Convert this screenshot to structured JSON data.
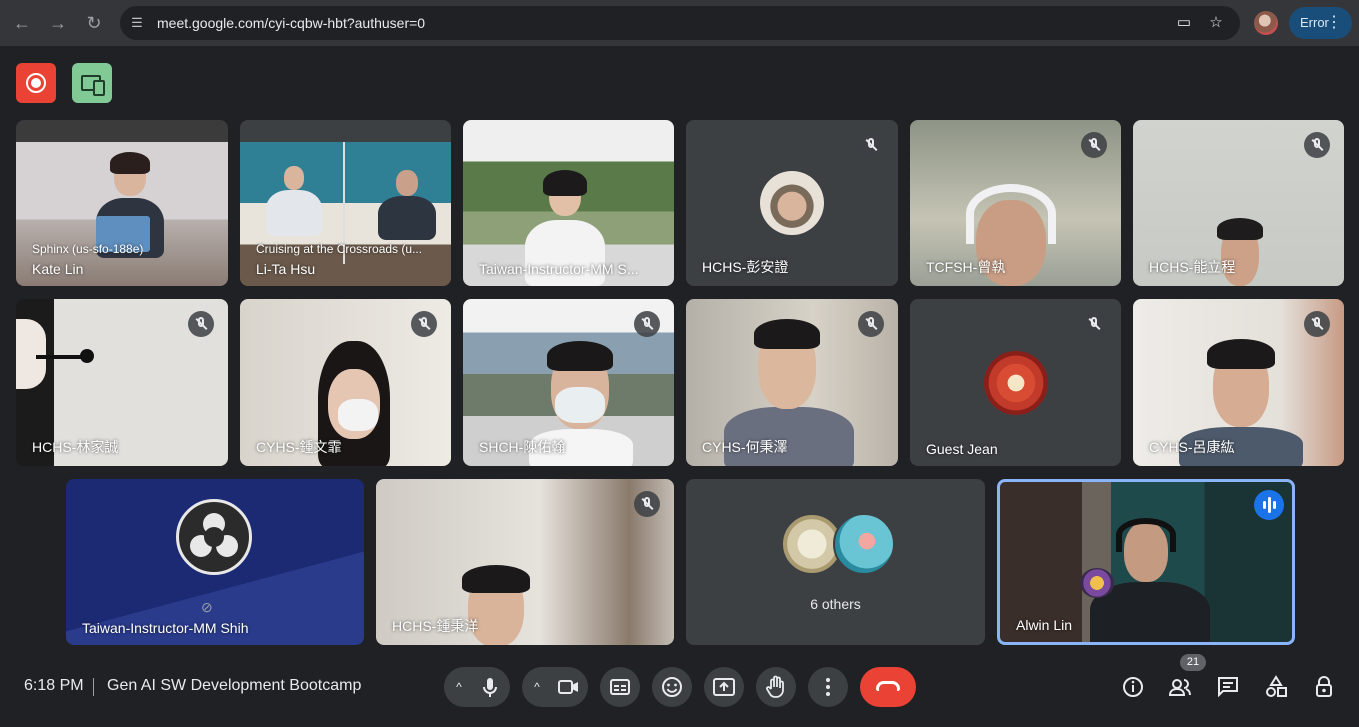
{
  "browser": {
    "url": "meet.google.com/cyi-cqbw-hbt?authuser=0",
    "error_label": "Error"
  },
  "tiles": [
    {
      "name": "Kate Lin",
      "subtitle": "Sphinx (us-sfo-188e)"
    },
    {
      "name": "Li-Ta Hsu",
      "subtitle": "Cruising at the Crossroads (u..."
    },
    {
      "name": "Taiwan-Instructor-MM S..."
    },
    {
      "name": "HCHS-彭安證"
    },
    {
      "name": "TCFSH-曾執"
    },
    {
      "name": "HCHS-能立程"
    },
    {
      "name": "HCHS-林家誠"
    },
    {
      "name": "CYHS-鍾文霏"
    },
    {
      "name": "SHCH-陳佑翰"
    },
    {
      "name": "CYHS-何秉澤"
    },
    {
      "name": "Guest Jean"
    },
    {
      "name": "CYHS-呂康紘"
    },
    {
      "name": "Taiwan-Instructor-MM Shih"
    },
    {
      "name": "HCHS-鍾秉洋"
    },
    {
      "name": "6 others"
    },
    {
      "name": "Alwin Lin"
    }
  ],
  "footer": {
    "time": "6:18 PM",
    "meeting_title": "Gen AI SW Development Bootcamp",
    "participant_count": "21"
  },
  "colors": {
    "background": "#202124",
    "tile": "#3c4043",
    "leave": "#ea4335",
    "speaking_border": "#8ab4f8",
    "record": "#ea4335",
    "companion": "#81c995"
  }
}
